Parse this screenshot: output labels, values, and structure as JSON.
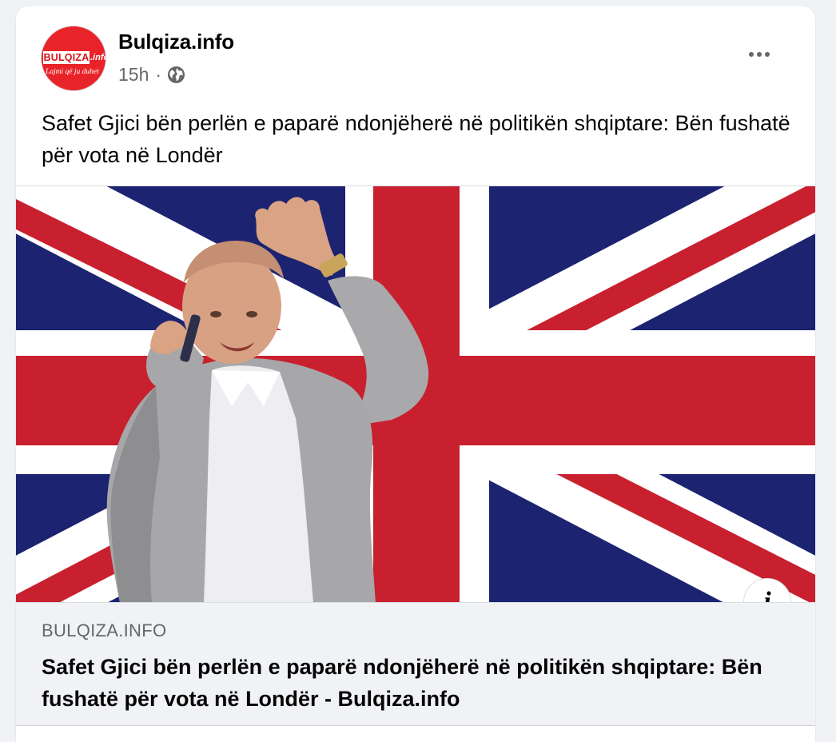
{
  "post": {
    "page_name": "Bulqiza.info",
    "timestamp": "15h",
    "separator": "·",
    "privacy_icon": "globe-icon",
    "more_icon": "more-horizontal-icon",
    "text": "Safet Gjici bën perlën e paparë ndonjëherë në politikën shqiptare: Bën fushatë për vota në Londër"
  },
  "avatar": {
    "logo_text": "BULQIZA",
    "logo_ext": ".info",
    "logo_tagline": "Lajmi që ju duhet"
  },
  "link_preview": {
    "domain": "BULQIZA.INFO",
    "title": "Safet Gjici bën perlën e paparë ndonjëherë në politikën shqiptare: Bën fushatë për vota në Londër - Bulqiza.info",
    "info_label": "i",
    "image_subject": "man-on-phone-union-jack-photo"
  },
  "colors": {
    "flag_blue": "#1c2370",
    "flag_red": "#c8202f",
    "flag_white": "#ffffff",
    "logo_red": "#e8242a",
    "text_secondary": "#65676b"
  }
}
